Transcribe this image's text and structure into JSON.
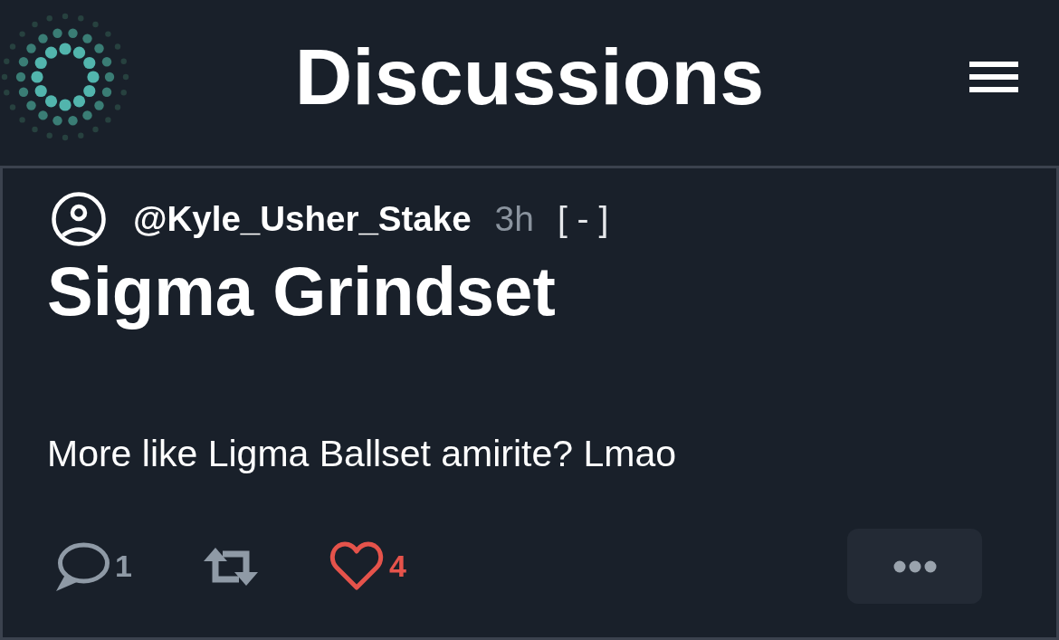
{
  "header": {
    "title": "Discussions"
  },
  "post": {
    "author": "@Kyle_Usher_Stake",
    "time": "3h",
    "collapse": "[ - ]",
    "title": "Sigma Grindset",
    "body": "More like Ligma Ballset amirite? Lmao",
    "actions": [
      {
        "kind": "comment",
        "count": "1",
        "active": false
      },
      {
        "kind": "repost",
        "active": false
      },
      {
        "kind": "like",
        "count": "4",
        "active": true
      }
    ]
  }
}
